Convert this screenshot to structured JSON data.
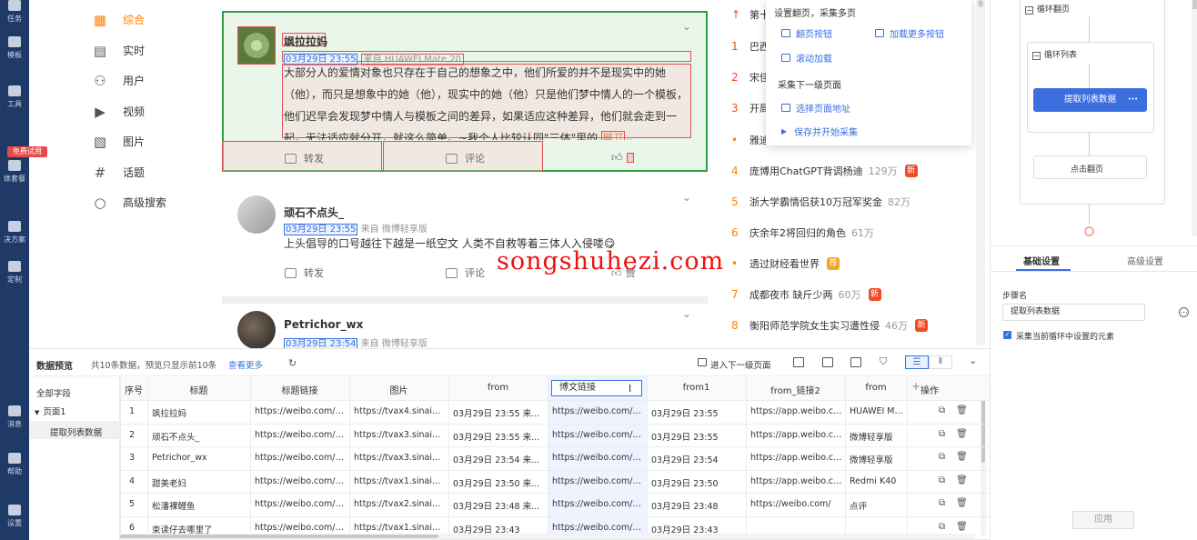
{
  "rail": {
    "items": [
      "任务",
      "模板",
      "工具",
      "体套餐",
      "决方案",
      "定制",
      "消息",
      "帮助",
      "设置"
    ],
    "badge": "免费试用"
  },
  "weibo_nav": {
    "items": [
      {
        "label": "综合",
        "icon": "grid-icon"
      },
      {
        "label": "实时",
        "icon": "realtime-icon"
      },
      {
        "label": "用户",
        "icon": "user-icon"
      },
      {
        "label": "视频",
        "icon": "video-icon"
      },
      {
        "label": "图片",
        "icon": "image-icon"
      },
      {
        "label": "话题",
        "icon": "hashtag-icon"
      },
      {
        "label": "高级搜索",
        "icon": "search-icon"
      }
    ]
  },
  "posts": [
    {
      "name": "飒拉拉妈",
      "time": "03月29日 23:55",
      "source": "来自 HUAWEI Mate 20",
      "text": "大部分人的爱情对象也只存在于自己的想象之中，他们所爱的并不是现实中的她（他），而只是想象中的她（他），现实中的她（他）只是他们梦中情人的一个模板，他们迟早会发现梦中情人与模板之间的差异，如果适应这种差异，他们就会走到一起，无法适应就分开，就这么简单。~我个人比较认同\"三体\"里的",
      "expand": "展开",
      "repost": "转发",
      "comment": "评论"
    },
    {
      "name": "顽石不点头_",
      "time": "03月29日 23:55",
      "source": "来自 微博轻享版",
      "text": "上头倡导的口号越往下越是一纸空文 人类不自救等着三体人入侵喽😋",
      "repost": "转发",
      "comment": "评论",
      "like": "赞"
    },
    {
      "name": "Petrichor_wx",
      "time": "03月29日 23:54",
      "source": "来自 微博轻享版"
    }
  ],
  "hot": [
    {
      "rank": "",
      "title": "第十",
      "count": "",
      "tag": ""
    },
    {
      "rank": "1",
      "title": "巴西",
      "count": "",
      "tag": ""
    },
    {
      "rank": "2",
      "title": "宋佳",
      "count": "",
      "tag": ""
    },
    {
      "rank": "3",
      "title": "开局",
      "count": "",
      "tag": ""
    },
    {
      "rank": "•",
      "title": "雅迪",
      "count": "",
      "tag": ""
    },
    {
      "rank": "4",
      "title": "庞博用ChatGPT背调杨迪",
      "count": "129万",
      "tag": "新"
    },
    {
      "rank": "5",
      "title": "浙大学霸情侣获10万冠军奖金",
      "count": "82万",
      "tag": ""
    },
    {
      "rank": "6",
      "title": "庆余年2将回归的角色",
      "count": "61万",
      "tag": ""
    },
    {
      "rank": "•",
      "title": "透过财经看世界",
      "count": "",
      "tag": "荐"
    },
    {
      "rank": "7",
      "title": "成都夜市 缺斤少两",
      "count": "60万",
      "tag": "新"
    },
    {
      "rank": "8",
      "title": "衡阳师范学院女生实习遭性侵",
      "count": "46万",
      "tag": "新"
    }
  ],
  "popup": {
    "h1": "设置翻页，采集多页",
    "i1": "翻页按钮",
    "i2": "加载更多按钮",
    "i3": "滚动加载",
    "h2": "采集下一级页面",
    "i4": "选择页面地址",
    "i5": "保存并开始采集"
  },
  "watermark": "songshuhezi.com",
  "flow": {
    "loop_page": "循环翻页",
    "loop_list": "循环列表",
    "extract": "提取列表数据",
    "click_page": "点击翻页",
    "tab_basic": "基础设置",
    "tab_adv": "高级设置",
    "step_label": "步骤名",
    "step_value": "提取列表数据",
    "checkbox": "采集当前循环中设置的元素",
    "apply": "应用"
  },
  "preview": {
    "title": "数据预览",
    "summary": "共10条数据，预览只显示前10条",
    "more": "查看更多",
    "next_level": "进入下一级页面",
    "fields_title": "全部字段",
    "page_node": "页面1",
    "list_node": "提取列表数据",
    "columns": [
      "序号",
      "标题",
      "标题链接",
      "图片",
      "from",
      "博文链接",
      "from1",
      "from_链接2",
      "from",
      "操作"
    ],
    "rows": [
      [
        "1",
        "飒拉拉妈",
        "https://weibo.com/1...",
        "https://tvax4.sinaimg...",
        "03月29日 23:55  来...",
        "https://weibo.com/1...",
        "03月29日 23:55",
        "https://app.weibo.co...",
        "HUAWEI Mate"
      ],
      [
        "2",
        "顽石不点头_",
        "https://weibo.com/7...",
        "https://tvax3.sinaimg...",
        "03月29日 23:55  来...",
        "https://weibo.com/7...",
        "03月29日 23:55",
        "https://app.weibo.co...",
        "微博轻享版"
      ],
      [
        "3",
        "Petrichor_wx",
        "https://weibo.com/6...",
        "https://tvax3.sinaimg...",
        "03月29日 23:54  来...",
        "https://weibo.com/6...",
        "03月29日 23:54",
        "https://app.weibo.co...",
        "微博轻享版"
      ],
      [
        "4",
        "甜美老妇",
        "https://weibo.com/6...",
        "https://tvax1.sinaimg...",
        "03月29日 23:50  来...",
        "https://weibo.com/6...",
        "03月29日 23:50",
        "https://app.weibo.co...",
        "Redmi K40"
      ],
      [
        "5",
        "松潘裸鲤鱼",
        "https://weibo.com/5...",
        "https://tvax2.sinaimg...",
        "03月29日 23:48  来...",
        "https://weibo.com/5...",
        "03月29日 23:48",
        "https://weibo.com/",
        "点评"
      ],
      [
        "6",
        "束读仔去哪里了",
        "https://weibo.com/5...",
        "https://tvax1.sinaimg...",
        "03月29日 23:43",
        "https://weibo.com/5...",
        "03月29日 23:43",
        "",
        ""
      ]
    ]
  },
  "colors": {
    "accent": "#ff8200",
    "blue": "#3b6fe0",
    "rail": "#1f3a66",
    "hl_green": "#2e9e44",
    "hl_red": "#e05252"
  }
}
